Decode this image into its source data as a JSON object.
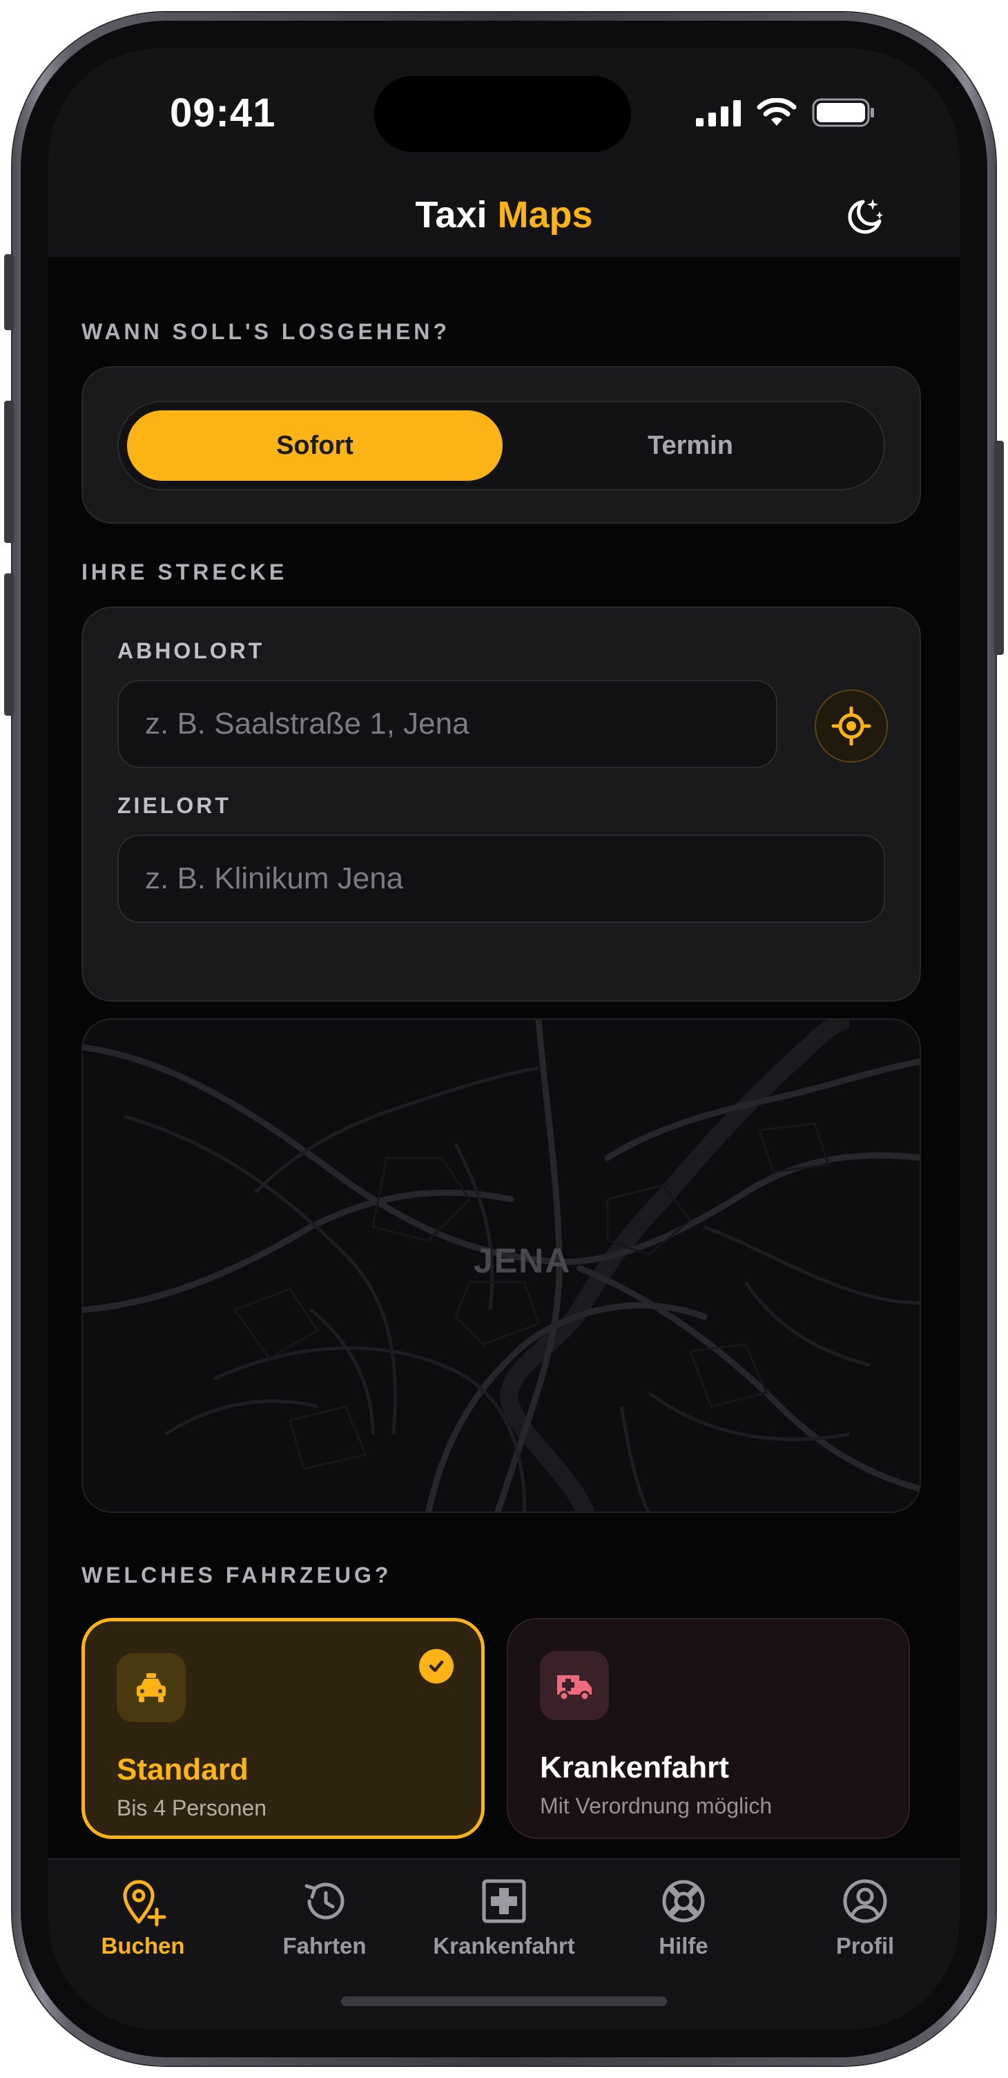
{
  "status": {
    "time": "09:41"
  },
  "header": {
    "title_main": "Taxi",
    "title_accent": "Maps",
    "accent_color": "#FBB315"
  },
  "when": {
    "label": "WANN SOLL'S LOSGEHEN?",
    "options": [
      {
        "label": "Sofort",
        "selected": true
      },
      {
        "label": "Termin",
        "selected": false
      }
    ]
  },
  "route": {
    "label": "IHRE STRECKE",
    "pickup": {
      "label": "ABHOLORT",
      "placeholder": "z. B. Saalstraße 1, Jena",
      "value": ""
    },
    "destination": {
      "label": "ZIELORT",
      "placeholder": "z. B. Klinikum Jena",
      "value": ""
    }
  },
  "map": {
    "city_label": "JENA"
  },
  "vehicle": {
    "label": "WELCHES FAHRZEUG?",
    "options": [
      {
        "title": "Standard",
        "subtitle": "Bis 4 Personen",
        "selected": true,
        "icon": "taxi-icon"
      },
      {
        "title": "Krankenfahrt",
        "subtitle": "Mit Verordnung möglich",
        "selected": false,
        "icon": "ambulance-icon"
      }
    ]
  },
  "tabs": [
    {
      "label": "Buchen",
      "icon": "map-pin-plus-icon",
      "active": true
    },
    {
      "label": "Fahrten",
      "icon": "history-icon",
      "active": false
    },
    {
      "label": "Krankenfahrt",
      "icon": "medical-cross-icon",
      "active": false
    },
    {
      "label": "Hilfe",
      "icon": "lifebuoy-icon",
      "active": false
    },
    {
      "label": "Profil",
      "icon": "user-circle-icon",
      "active": false
    }
  ]
}
